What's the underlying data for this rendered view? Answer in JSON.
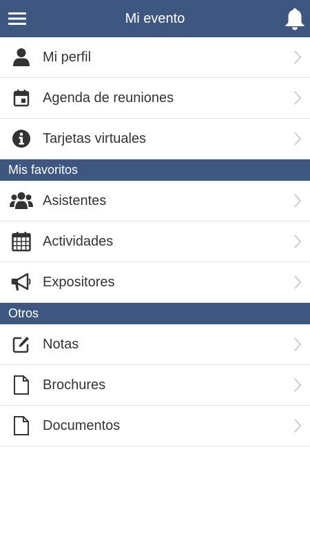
{
  "header": {
    "title": "Mi evento",
    "menu_icon": "hamburger-menu-icon",
    "bell_icon": "bell-icon"
  },
  "main_items": [
    {
      "label": "Mi perfil",
      "icon": "user-icon"
    },
    {
      "label": "Agenda de reuniones",
      "icon": "calendar-day-icon"
    },
    {
      "label": "Tarjetas virtuales",
      "icon": "info-circle-icon"
    }
  ],
  "favorites": {
    "title": "Mis favoritos",
    "items": [
      {
        "label": "Asistentes",
        "icon": "users-group-icon"
      },
      {
        "label": "Actividades",
        "icon": "calendar-grid-icon"
      },
      {
        "label": "Expositores",
        "icon": "megaphone-icon"
      }
    ]
  },
  "others": {
    "title": "Otros",
    "items": [
      {
        "label": "Notas",
        "icon": "edit-note-icon"
      },
      {
        "label": "Brochures",
        "icon": "file-icon"
      },
      {
        "label": "Documentos",
        "icon": "file-icon"
      }
    ]
  },
  "colors": {
    "primary": "#3d5781",
    "text": "#333333",
    "divider": "#e0e0e0",
    "chevron": "#cccccc"
  }
}
